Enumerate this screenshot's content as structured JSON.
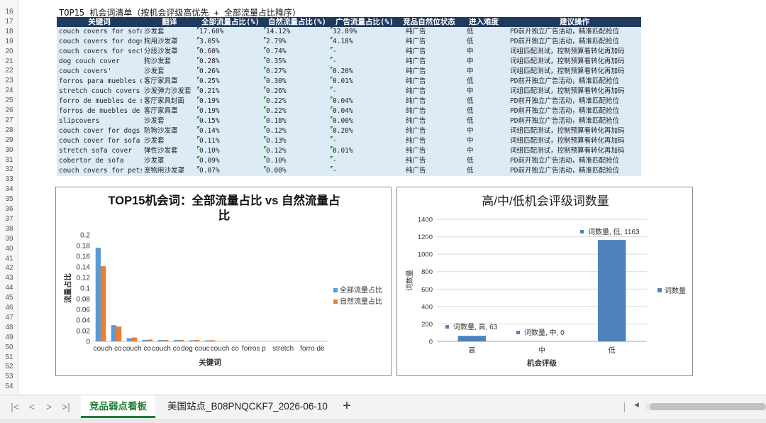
{
  "sheet": {
    "title": "TOP15 机会词清单（按机会评级高优先 + 全部流量占比降序）",
    "row_numbers": [
      16,
      17,
      18,
      19,
      20,
      21,
      22,
      23,
      24,
      25,
      26,
      27,
      28,
      29,
      30,
      31,
      32,
      33,
      34,
      35,
      36,
      37,
      38,
      39,
      40,
      41,
      42,
      43,
      44,
      45,
      46,
      47,
      48,
      49,
      50,
      51,
      52,
      53,
      54
    ]
  },
  "table": {
    "headers": [
      "关键词",
      "翻译",
      "全部流量占比(%)",
      "自然流量占比(%)",
      "广告流量占比(%)",
      "竞品自然位状态",
      "进入难度",
      "建议操作"
    ],
    "rows": [
      [
        "couch covers for sofa",
        "沙发套",
        "17.60%",
        "14.12%",
        "32.89%",
        "纯广告",
        "低",
        "PD前开独立广告活动，精准匹配抢位"
      ],
      [
        "couch covers for dogs",
        "狗用沙发罩",
        "3.05%",
        "2.79%",
        "4.18%",
        "纯广告",
        "低",
        "PD前开独立广告活动，精准匹配抢位"
      ],
      [
        "couch covers for sectio",
        "分段沙发罩",
        "0.60%",
        "0.74%",
        "-",
        "纯广告",
        "中",
        "词组匹配测试，控制预算看转化再加码"
      ],
      [
        "dog couch cover",
        "狗沙发套",
        "0.28%",
        "0.35%",
        "-",
        "纯广告",
        "中",
        "词组匹配测试，控制预算看转化再加码"
      ],
      [
        "couch covers'",
        "沙发套",
        "0.26%",
        "0.27%",
        "0.20%",
        "纯广告",
        "中",
        "词组匹配测试，控制预算看转化再加码"
      ],
      [
        "forros para muebles de",
        "客厅家具罩",
        "0.25%",
        "0.30%",
        "0.01%",
        "纯广告",
        "低",
        "PD前开独立广告活动，精准匹配抢位"
      ],
      [
        "stretch couch covers fo",
        "沙发弹力沙发套",
        "0.21%",
        "0.26%",
        "-",
        "纯广告",
        "中",
        "词组匹配测试，控制预算看转化再加码"
      ],
      [
        "forro de muebles de sal",
        "客厅家具封面",
        "0.19%",
        "0.22%",
        "0.04%",
        "纯广告",
        "低",
        "PD前开独立广告活动，精准匹配抢位"
      ],
      [
        "forros de muebles de sa",
        "客厅家具罩",
        "0.19%",
        "0.22%",
        "0.04%",
        "纯广告",
        "低",
        "PD前开独立广告活动，精准匹配抢位"
      ],
      [
        "slipcovers",
        "沙发套",
        "0.15%",
        "0.18%",
        "0.00%",
        "纯广告",
        "低",
        "PD前开独立广告活动，精准匹配抢位"
      ],
      [
        "couch cover for dogs",
        "防狗沙发罩",
        "0.14%",
        "0.12%",
        "0.20%",
        "纯广告",
        "中",
        "词组匹配测试，控制预算看转化再加码"
      ],
      [
        "couch cover for sofa",
        "沙发套",
        "0.11%",
        "0.13%",
        "-",
        "纯广告",
        "中",
        "词组匹配测试，控制预算看转化再加码"
      ],
      [
        "stretch sofa cover",
        "弹性沙发套",
        "0.10%",
        "0.12%",
        "0.01%",
        "纯广告",
        "中",
        "词组匹配测试，控制预算看转化再加码"
      ],
      [
        "cobertor de sofa",
        "沙发罩",
        "0.09%",
        "0.10%",
        "-",
        "纯广告",
        "低",
        "PD前开独立广告活动，精准匹配抢位"
      ],
      [
        "couch covers for pets",
        "宠物用沙发罩",
        "0.07%",
        "0.08%",
        "-",
        "纯广告",
        "低",
        "PD前开独立广告活动，精准匹配抢位"
      ]
    ]
  },
  "chart_data": [
    {
      "type": "bar",
      "title": "TOP15机会词：全部流量占比 vs 自然流量占比",
      "title_lines": [
        "TOP15机会词：全部流量占比 vs 自然流量占",
        "比"
      ],
      "xlabel": "关键词",
      "ylabel": "流量占比",
      "ylim": [
        0,
        0.2
      ],
      "yticks": [
        0,
        0.02,
        0.04,
        0.06,
        0.08,
        0.1,
        0.12,
        0.14,
        0.16,
        0.18,
        0.2
      ],
      "ytick_labels": [
        "0",
        "0.02",
        "0.04",
        "0.06",
        "0.08",
        "0.1",
        "0.12",
        "0.14",
        "0.16",
        "0.18",
        "0.2"
      ],
      "categories": [
        "couch co",
        "couch co",
        "couch co",
        "dog couc",
        "couch co",
        "forros p",
        "stretch",
        "forro de",
        "",
        "",
        "",
        "",
        "",
        "",
        ""
      ],
      "visible_tick_labels": [
        "couch co",
        "couch co",
        "couch co",
        "dog couc",
        "couch co",
        "forros p",
        "stretch",
        "forro de"
      ],
      "series": [
        {
          "name": "全部流量占比",
          "color": "#5b9bd5",
          "values": [
            0.176,
            0.0305,
            0.006,
            0.0028,
            0.0026,
            0.0025,
            0.0021,
            0.0019
          ]
        },
        {
          "name": "自然流量占比",
          "color": "#ed7d31",
          "values": [
            0.1412,
            0.0279,
            0.0074,
            0.0035,
            0.0027,
            0.003,
            0.0026,
            0.0022
          ]
        }
      ],
      "legend": "right",
      "grid": false
    },
    {
      "type": "bar",
      "title": "高/中/低机会评级词数量",
      "xlabel": "机会评级",
      "ylabel": "词数量",
      "ylim": [
        0,
        1400
      ],
      "yticks": [
        0,
        200,
        400,
        600,
        800,
        1000,
        1200,
        1400
      ],
      "ytick_labels": [
        "0",
        "200",
        "400",
        "600",
        "800",
        "1000",
        "1200",
        "1400"
      ],
      "categories": [
        "高",
        "中",
        "低"
      ],
      "series": [
        {
          "name": "词数量",
          "color": "#4f81bd",
          "values": [
            63,
            0,
            1163
          ]
        }
      ],
      "data_labels": [
        "词数量, 高, 63",
        "词数量, 中, 0",
        "词数量, 低, 1163"
      ],
      "legend": "right",
      "grid": true
    }
  ],
  "tabs": {
    "items": [
      {
        "label": "竞品弱点看板",
        "active": true
      },
      {
        "label": "美国站点_B08PNQCKF7_2026-06-10",
        "active": false
      }
    ],
    "add_label": "+",
    "nav": [
      "|<",
      "<",
      ">",
      ">|"
    ]
  },
  "colors": {
    "header_bg": "#1f3a5f",
    "row_bg": "#ddebf7",
    "active_tab": "#1e7e34"
  }
}
